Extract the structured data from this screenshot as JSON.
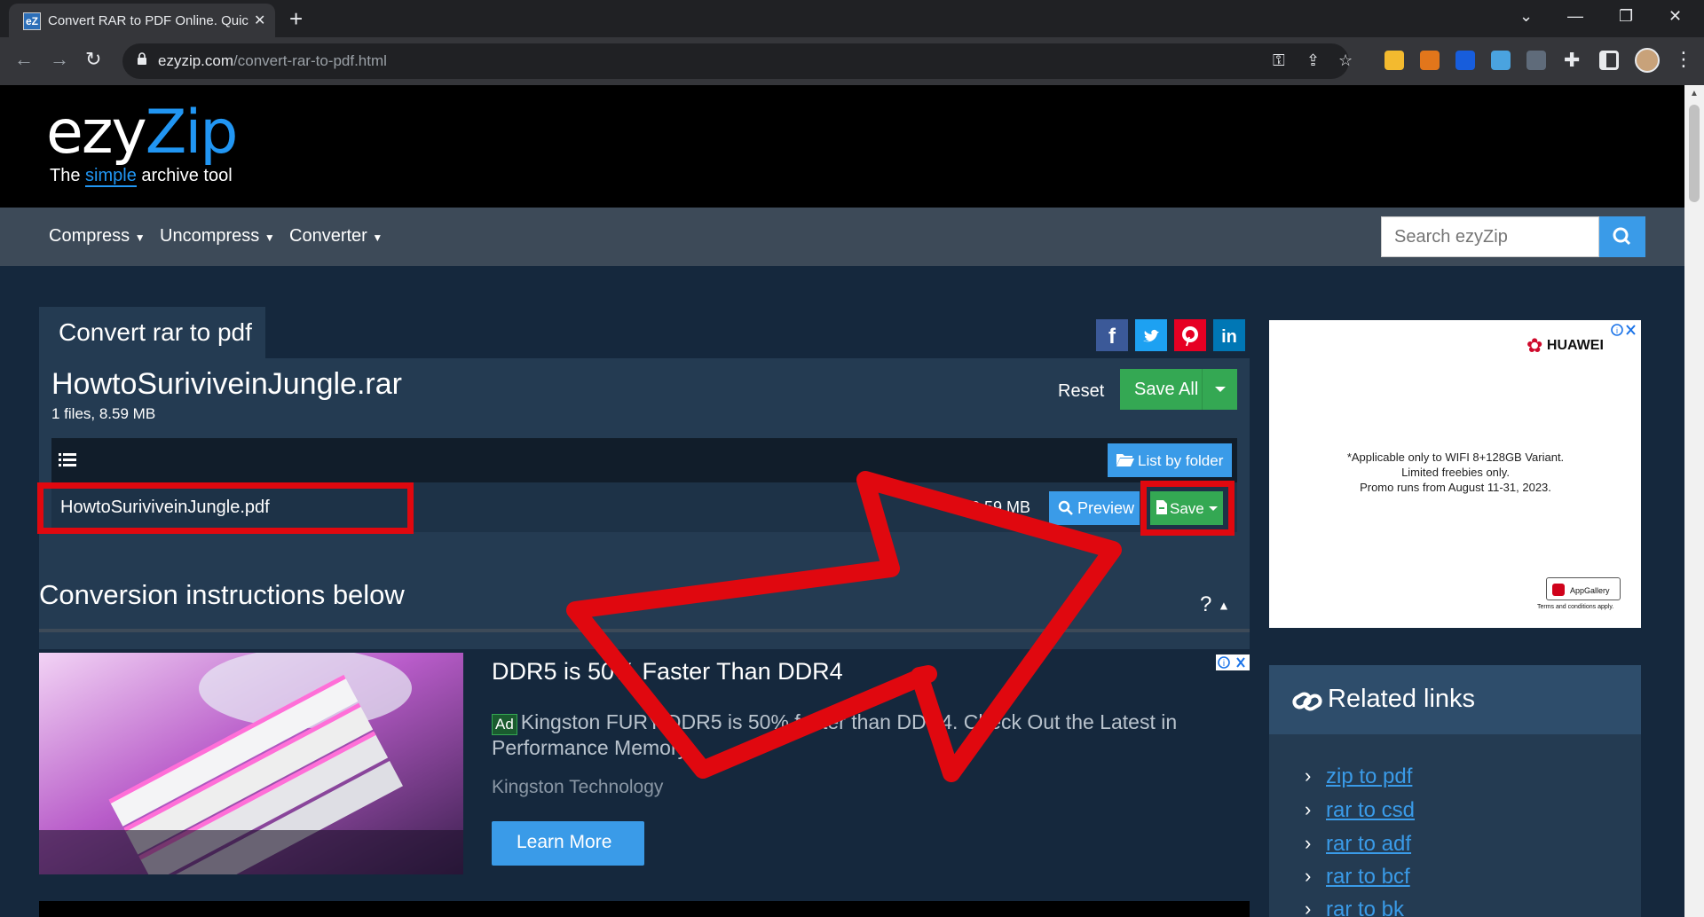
{
  "browser": {
    "tab_title": "Convert RAR to PDF Online. Quic",
    "tab_favicon_text": "eZ",
    "url_host": "ezyzip.com",
    "url_path": "/convert-rar-to-pdf.html"
  },
  "site": {
    "logo_main": "ezy",
    "logo_accent": "Zip",
    "tagline_pre": "The ",
    "tagline_accent": "simple",
    "tagline_post": " archive tool"
  },
  "nav": {
    "items": [
      "Compress",
      "Uncompress",
      "Converter"
    ],
    "search_placeholder": "Search ezyZip"
  },
  "converter": {
    "tab_label": "Convert rar to pdf",
    "archive_name": "HowtoSuriviveinJungle.rar",
    "archive_meta": "1 files, 8.59 MB",
    "reset_label": "Reset",
    "save_all_label": "Save All",
    "list_by_folder_label": "List by folder",
    "file": {
      "name": "HowtoSuriviveinJungle.pdf",
      "size": "8.59 MB",
      "preview_label": "Preview",
      "save_label": "Save"
    }
  },
  "instructions": {
    "title": "Conversion instructions below",
    "toggle": "?"
  },
  "ad": {
    "headline": "DDR5 is 50% Faster Than DDR4",
    "badge": "Ad",
    "body": "Kingston FURY DDR5 is 50% faster than DDR4. Check Out the Latest in Performance Memory.",
    "advertiser": "Kingston Technology",
    "cta": "Learn More"
  },
  "side_ad": {
    "brand": "HUAWEI",
    "text_lines": [
      "*Applicable only to WIFI 8+128GB Variant.",
      "Limited freebies only.",
      "Promo runs from August 11-31, 2023."
    ],
    "badge": "AppGallery",
    "terms": "Terms and conditions apply."
  },
  "related": {
    "title": "Related links",
    "links": [
      "zip to pdf",
      "rar to csd",
      "rar to adf",
      "rar to bcf",
      "rar to bk"
    ]
  },
  "colors": {
    "page_bg": "#15283d",
    "accent_blue": "#3a9be8",
    "save_green": "#34a853",
    "annotation_red": "#e0080f"
  }
}
